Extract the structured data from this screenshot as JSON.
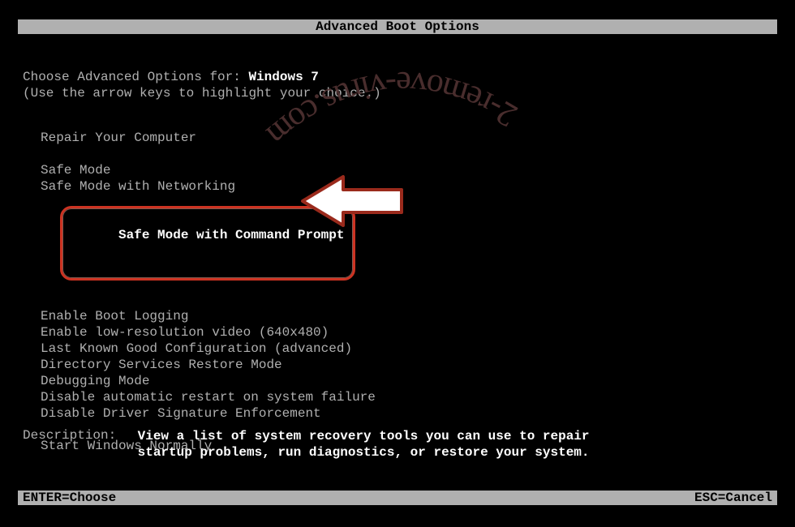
{
  "title": "Advanced Boot Options",
  "prompt": {
    "prefix": "Choose Advanced Options for: ",
    "os": "Windows 7"
  },
  "instruction": "(Use the arrow keys to highlight your choice.)",
  "options": {
    "repair": "Repair Your Computer",
    "group1": [
      "Safe Mode",
      "Safe Mode with Networking",
      "Safe Mode with Command Prompt"
    ],
    "group2": [
      "Enable Boot Logging",
      "Enable low-resolution video (640x480)",
      "Last Known Good Configuration (advanced)",
      "Directory Services Restore Mode",
      "Debugging Mode",
      "Disable automatic restart on system failure",
      "Disable Driver Signature Enforcement"
    ],
    "group3": [
      "Start Windows Normally"
    ]
  },
  "selected_index": 2,
  "description": {
    "label": "Description:",
    "body": "View a list of system recovery tools you can use to repair startup problems, run diagnostics, or restore your system."
  },
  "footer": {
    "left": "ENTER=Choose",
    "right": "ESC=Cancel"
  },
  "watermark": "2-remove-virus.com"
}
